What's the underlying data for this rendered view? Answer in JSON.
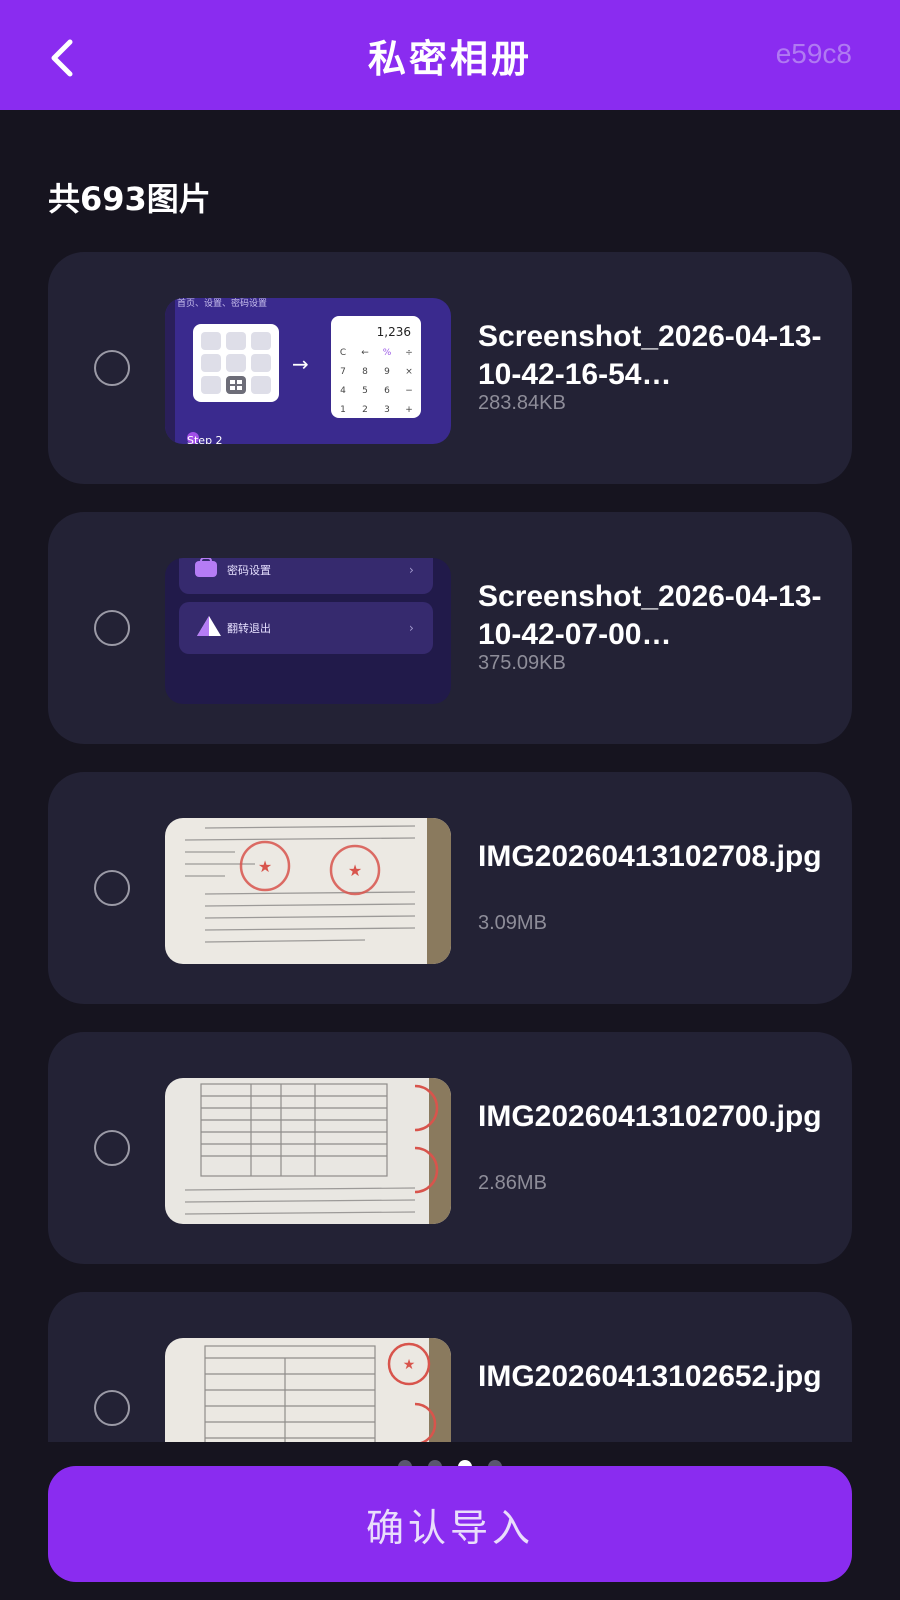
{
  "header": {
    "title": "私密相册",
    "code": "e59c8"
  },
  "summary": {
    "count_label": "共693图片"
  },
  "files": [
    {
      "name": "Screenshot_2026-04-13-10-42-16-54…",
      "size": "283.84KB",
      "thumb": {
        "type": "calculator-guide",
        "top_text": "首页、设置、密码设置",
        "display": "1,236",
        "keys": [
          "C",
          "←",
          "%",
          "÷",
          "7",
          "8",
          "9",
          "×",
          "4",
          "5",
          "6",
          "−",
          "1",
          "2",
          "3",
          "+"
        ],
        "step": "Step 2"
      }
    },
    {
      "name": "Screenshot_2026-04-13-10-42-07-00…",
      "size": "375.09KB",
      "thumb": {
        "type": "settings-menu",
        "item1": "密码设置",
        "item2": "翻转退出"
      }
    },
    {
      "name": "IMG20260413102708.jpg",
      "size": "3.09MB",
      "thumb": {
        "type": "document-stamped"
      }
    },
    {
      "name": "IMG20260413102700.jpg",
      "size": "2.86MB",
      "thumb": {
        "type": "document-table"
      }
    },
    {
      "name": "IMG20260413102652.jpg",
      "size": "",
      "thumb": {
        "type": "document-form"
      }
    }
  ],
  "pager": {
    "count": 4,
    "active_index": 2
  },
  "confirm_label": "确认导入",
  "colors": {
    "accent": "#8a2cf0",
    "background": "#16141f",
    "card": "#232235",
    "muted_text": "#8e8d99"
  }
}
